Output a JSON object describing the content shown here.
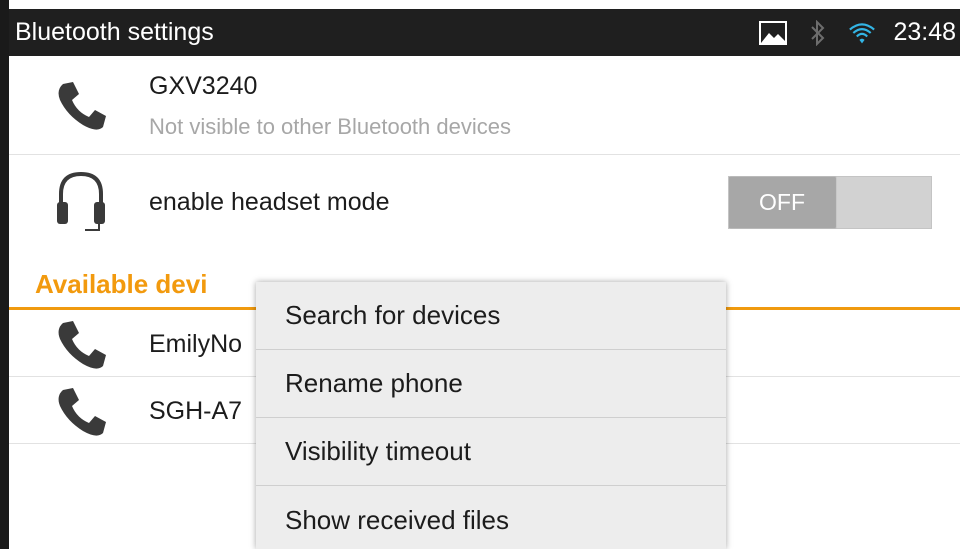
{
  "header": {
    "title": "Bluetooth settings",
    "time": "23:48",
    "icons": [
      "picture-icon",
      "bluetooth-icon",
      "wifi-icon"
    ]
  },
  "device": {
    "name": "GXV3240",
    "visibility": "Not visible to other Bluetooth devices"
  },
  "headset": {
    "label": "enable headset mode",
    "toggle_state": "OFF"
  },
  "available": {
    "section_label": "Available devi",
    "devices": [
      {
        "name": "EmilyNo"
      },
      {
        "name": "SGH-A7"
      }
    ]
  },
  "menu": {
    "items": [
      {
        "label": "Search for devices"
      },
      {
        "label": "Rename phone"
      },
      {
        "label": "Visibility timeout"
      },
      {
        "label": "Show received files"
      }
    ]
  },
  "colors": {
    "accent": "#f29a0e",
    "titlebar": "#1f1f1f",
    "secondary_text": "#a7a7a7",
    "wifi": "#33b5e5"
  }
}
